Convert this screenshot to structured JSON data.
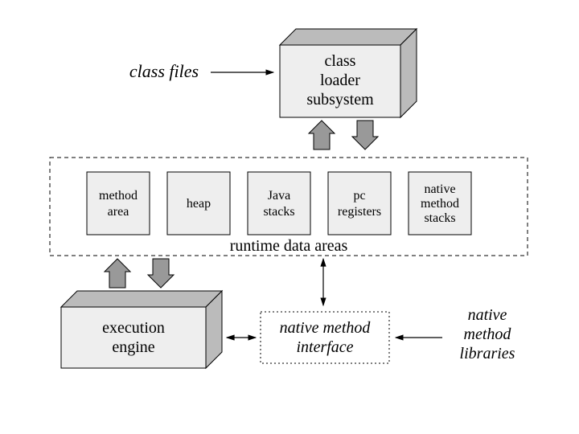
{
  "labels": {
    "class_files": "class files",
    "class_loader_l1": "class",
    "class_loader_l2": "loader",
    "class_loader_l3": "subsystem",
    "method_area_l1": "method",
    "method_area_l2": "area",
    "heap": "heap",
    "java_stacks_l1": "Java",
    "java_stacks_l2": "stacks",
    "pc_registers_l1": "pc",
    "pc_registers_l2": "registers",
    "native_stacks_l1": "native",
    "native_stacks_l2": "method",
    "native_stacks_l3": "stacks",
    "runtime_data_areas": "runtime data areas",
    "execution_engine_l1": "execution",
    "execution_engine_l2": "engine",
    "native_method_interface_l1": "native method",
    "native_method_interface_l2": "interface",
    "native_libs_l1": "native",
    "native_libs_l2": "method",
    "native_libs_l3": "libraries"
  },
  "colors": {
    "box_fill": "#eeeeee",
    "box_side": "#bbbbbb",
    "arrow_fill": "#999999"
  }
}
